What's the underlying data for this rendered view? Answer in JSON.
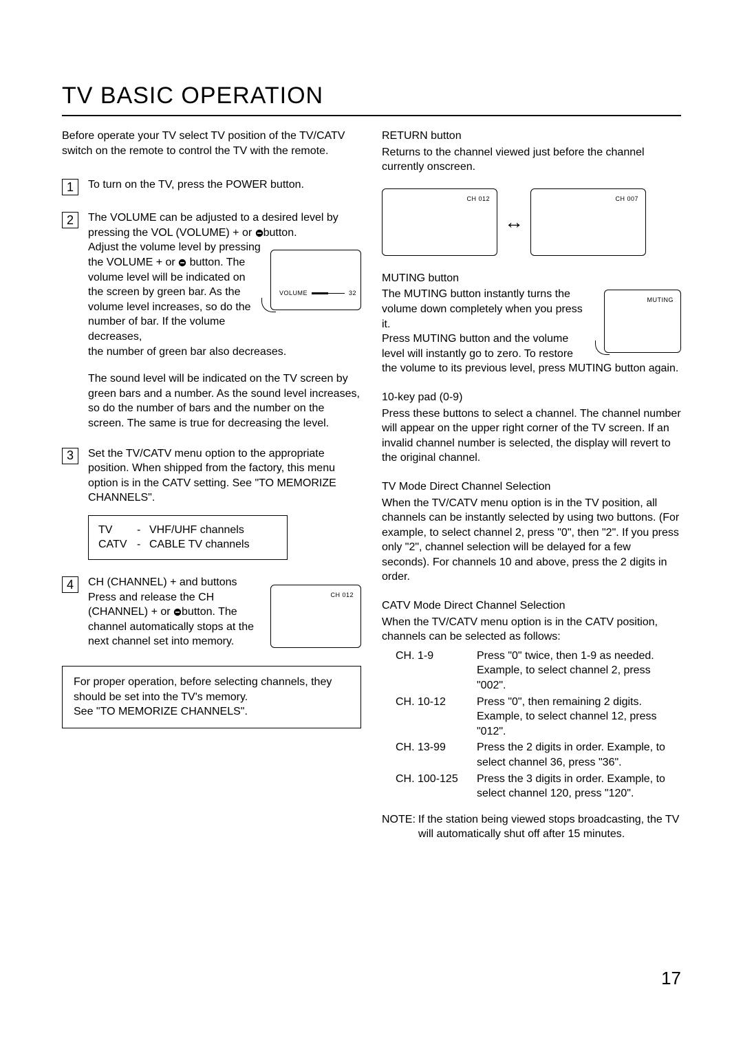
{
  "title": "TV BASIC OPERATION",
  "page_number": "17",
  "left": {
    "intro": "Before operate your TV select TV position of the TV/CATV switch on the remote to control the TV with the remote.",
    "step1": "To turn on the TV, press the POWER button.",
    "step2_a": "The VOLUME can be adjusted to a desired level by pressing the VOL (VOLUME) + or ",
    "step2_a_end": "button.",
    "step2_b": "Adjust the volume level by pressing the VOLUME + or ",
    "step2_b_cont": " button. The volume level will be indicated on the screen by green bar. As the volume level increases, so do the number of bar. If the volume decreases,",
    "step2_c": "the number of green bar also decreases.",
    "step2_d": "The sound level will be indicated on the TV screen by green bars and a number. As the sound level increases, so do the number of bars and the number on the screen. The same is true for decreasing the level.",
    "volume_label": "VOLUME",
    "volume_value": "32",
    "step3": "Set the TV/CATV menu option to the appropriate position. When shipped from the factory, this menu option is in the CATV setting. See \"TO MEMORIZE CHANNELS\".",
    "tvmodes": [
      {
        "k": "TV",
        "d": "-",
        "v": "VHF/UHF channels"
      },
      {
        "k": "CATV",
        "d": "-",
        "v": "CABLE TV channels"
      }
    ],
    "step4_a": "CH (CHANNEL) + and     buttons",
    "step4_b": "Press and release the CH (CHANNEL) + or ",
    "step4_b_end": "button. The channel automatically stops at the next channel set into memory.",
    "step4_screen_ch": "CH 012",
    "notebox": "For proper operation, before selecting channels, they should be set into the TV's memory.\nSee \"TO MEMORIZE CHANNELS\"."
  },
  "right": {
    "return_title": "RETURN button",
    "return_text": "Returns to the channel viewed just before the channel currently onscreen.",
    "return_ch1": "CH 012",
    "return_ch2": "CH 007",
    "muting_title": "MUTING button",
    "muting_text_a": "The MUTING button instantly turns the volume down completely when you press it.",
    "muting_text_b": "Press MUTING button and the volume level will instantly go to zero. To restore",
    "muting_text_c": "the volume to its previous level, press MUTING button again.",
    "muting_label": "MUTING",
    "keypad_title": "10-key pad (0-9)",
    "keypad_text": "Press these buttons to select a channel. The channel number will appear on the upper right corner of the TV screen. If an invalid channel number is selected, the display will revert to the original channel.",
    "tvmode_title": "TV Mode Direct Channel Selection",
    "tvmode_text": "When the TV/CATV menu option is in the TV position, all channels can be instantly selected by using two buttons. (For example, to select channel 2, press \"0\", then \"2\". If you press only \"2\", channel selection will be delayed for a few seconds). For channels 10 and above, press the 2 digits in order.",
    "catvmode_title": "CATV Mode Direct Channel Selection",
    "catvmode_text": "When the TV/CATV menu option is in the CATV position, channels can be selected as follows:",
    "catv_rows": [
      {
        "k": "CH. 1-9",
        "v": "Press \"0\" twice, then 1-9 as needed. Example, to select channel 2, press \"002\"."
      },
      {
        "k": "CH. 10-12",
        "v": "Press \"0\", then remaining 2 digits. Example, to select channel 12, press \"012\"."
      },
      {
        "k": "CH. 13-99",
        "v": "Press the 2 digits in order. Example, to select channel 36, press \"36\"."
      },
      {
        "k": "CH. 100-125",
        "v": "Press the 3 digits in order. Example, to select channel 120, press \"120\"."
      }
    ],
    "note_label": "NOTE:",
    "note_text": "If the station being viewed stops broadcasting, the TV will automatically shut off after 15 minutes."
  }
}
